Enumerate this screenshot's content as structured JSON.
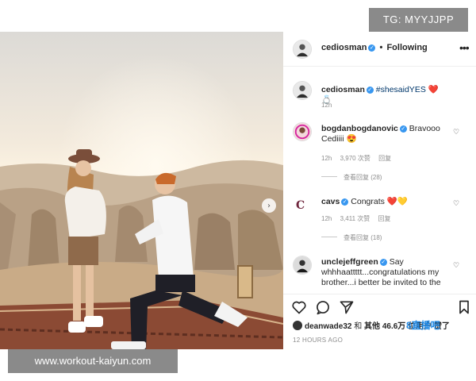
{
  "watermark_top": "TG: MYYJJPP",
  "watermark_bottom": "www.workout-kaiyun.com",
  "brand_logo": "8直播吧",
  "post": {
    "username": "cediosman",
    "follow_label": "Following",
    "more_icon": "more-horizontal-icon"
  },
  "caption": {
    "username": "cediosman",
    "hashtag": "#shesaidYES",
    "emoji": "❤️💍",
    "time": "12h"
  },
  "comments": [
    {
      "username": "bogdanbogdanovic",
      "text": "Bravooo Cediiii 😍",
      "time": "12h",
      "likes": "3,970 次赞",
      "reply": "回复",
      "view_replies": "查看回复 (28)"
    },
    {
      "username": "cavs",
      "text": "Congrats ❤️💛",
      "time": "12h",
      "likes": "3,411 次赞",
      "reply": "回复",
      "view_replies": "查看回复 (18)"
    },
    {
      "username": "unclejeffgreen",
      "text": "Say whhhaattttt...congratulations my brother...i better be invited to the"
    }
  ],
  "likes_line": {
    "user": "deanwade32",
    "joiner": "和",
    "others": "其他 46.6万 位用户 赞了"
  },
  "timestamp": "12 HOURS AGO",
  "colors": {
    "verified": "#3897f0",
    "secondary_text": "#8e8e8e",
    "watermark_bg": "#8a8a8a"
  }
}
